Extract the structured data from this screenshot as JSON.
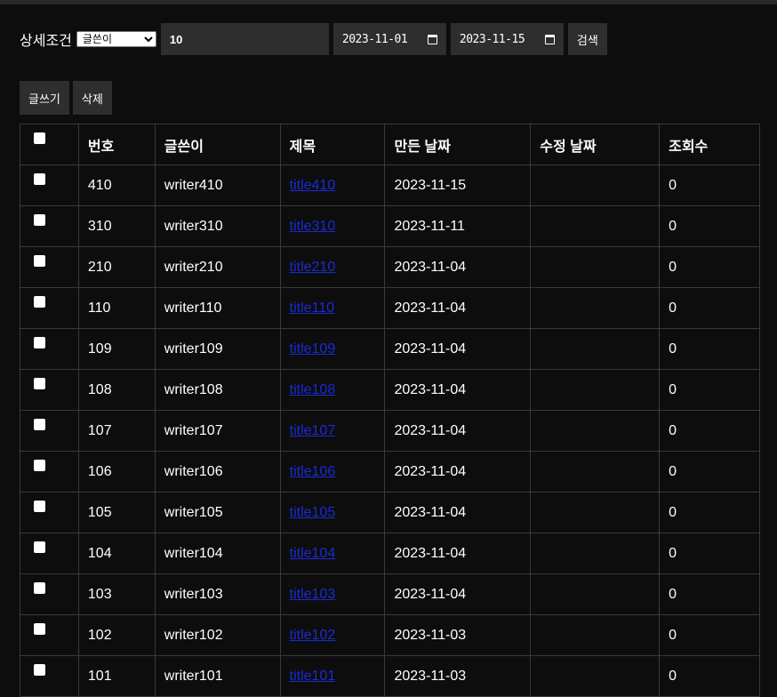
{
  "search": {
    "label": "상세조건",
    "condition_selected": "글쓴이",
    "keyword_value": "10",
    "date_from": "2023-11-01",
    "date_to": "2023-11-15",
    "search_button": "검색"
  },
  "actions": {
    "write_button": "글쓰기",
    "delete_button": "삭제"
  },
  "table": {
    "headers": [
      "번호",
      "글쓴이",
      "제목",
      "만든 날짜",
      "수정 날짜",
      "조회수"
    ],
    "rows": [
      {
        "no": "410",
        "writer": "writer410",
        "title": "title410",
        "created": "2023-11-15",
        "updated": "",
        "views": "0"
      },
      {
        "no": "310",
        "writer": "writer310",
        "title": "title310",
        "created": "2023-11-11",
        "updated": "",
        "views": "0"
      },
      {
        "no": "210",
        "writer": "writer210",
        "title": "title210",
        "created": "2023-11-04",
        "updated": "",
        "views": "0"
      },
      {
        "no": "110",
        "writer": "writer110",
        "title": "title110",
        "created": "2023-11-04",
        "updated": "",
        "views": "0"
      },
      {
        "no": "109",
        "writer": "writer109",
        "title": "title109",
        "created": "2023-11-04",
        "updated": "",
        "views": "0"
      },
      {
        "no": "108",
        "writer": "writer108",
        "title": "title108",
        "created": "2023-11-04",
        "updated": "",
        "views": "0"
      },
      {
        "no": "107",
        "writer": "writer107",
        "title": "title107",
        "created": "2023-11-04",
        "updated": "",
        "views": "0"
      },
      {
        "no": "106",
        "writer": "writer106",
        "title": "title106",
        "created": "2023-11-04",
        "updated": "",
        "views": "0"
      },
      {
        "no": "105",
        "writer": "writer105",
        "title": "title105",
        "created": "2023-11-04",
        "updated": "",
        "views": "0"
      },
      {
        "no": "104",
        "writer": "writer104",
        "title": "title104",
        "created": "2023-11-04",
        "updated": "",
        "views": "0"
      },
      {
        "no": "103",
        "writer": "writer103",
        "title": "title103",
        "created": "2023-11-04",
        "updated": "",
        "views": "0"
      },
      {
        "no": "102",
        "writer": "writer102",
        "title": "title102",
        "created": "2023-11-03",
        "updated": "",
        "views": "0"
      },
      {
        "no": "101",
        "writer": "writer101",
        "title": "title101",
        "created": "2023-11-03",
        "updated": "",
        "views": "0"
      }
    ]
  }
}
